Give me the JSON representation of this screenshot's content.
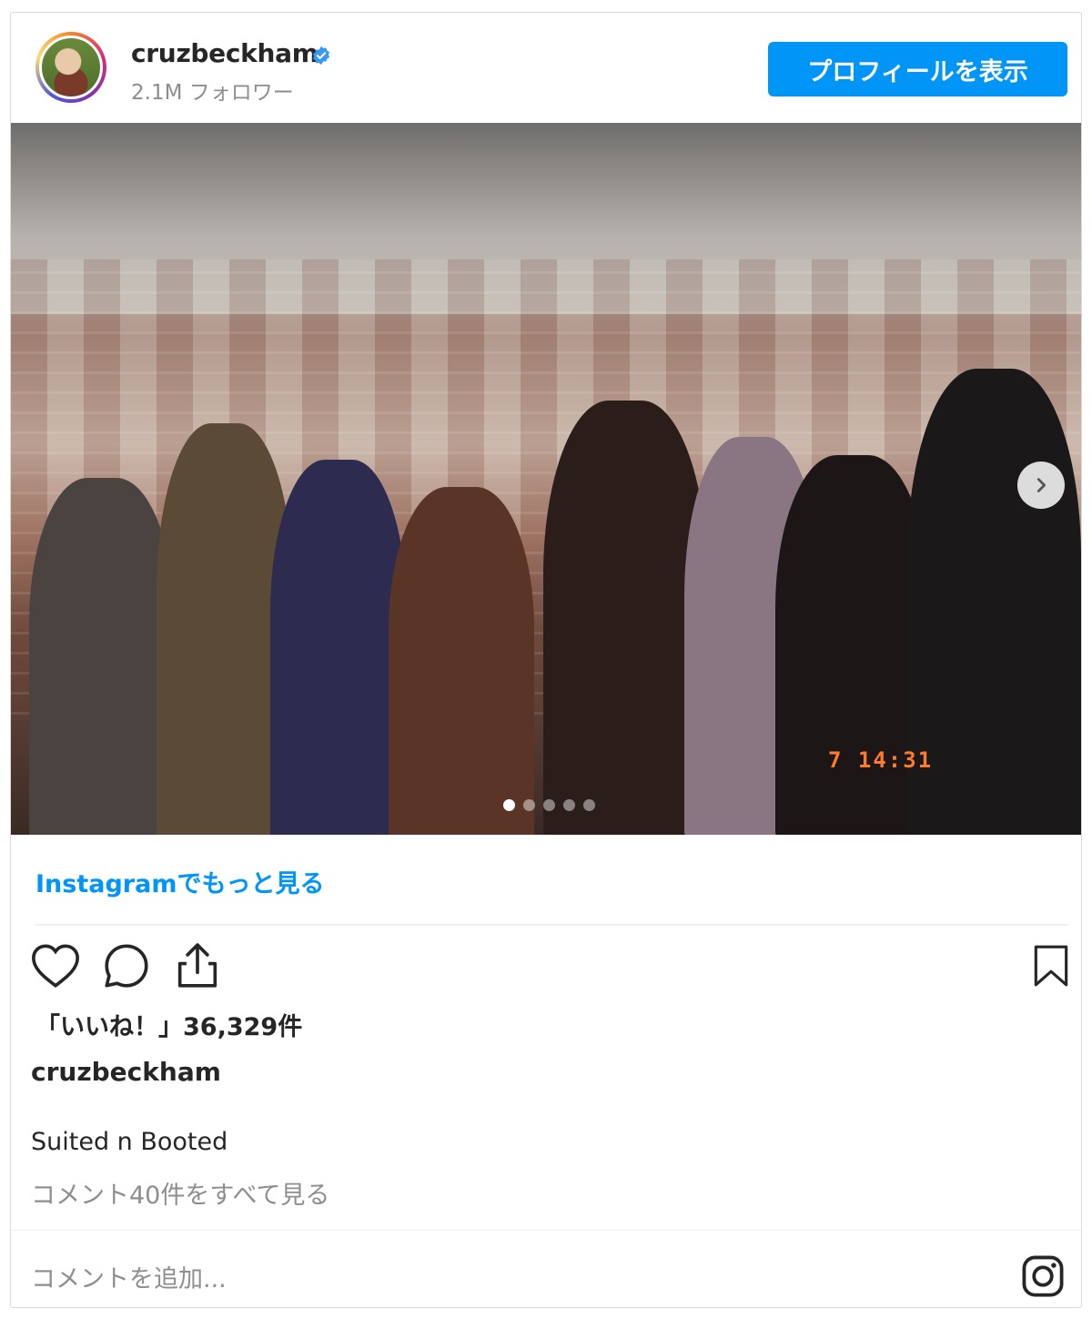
{
  "post": {
    "username": "cruzbeckham",
    "followers": "2.1M フォロワー",
    "profile_button": "プロフィールを表示",
    "carousel": {
      "current": 1,
      "total": 5
    },
    "photo_timestamp": "7 14:31",
    "more_link": "Instagramでもっと見る",
    "likes": "「いいね！」36,329件",
    "caption_username": "cruzbeckham",
    "caption": "Suited n Booted",
    "view_comments": "コメント40件をすべて見る",
    "add_comment_placeholder": "コメントを追加..."
  },
  "colors": {
    "accent": "#0095f6",
    "verified": "#3897f0",
    "secondary_text": "#8e8e8e"
  },
  "icons": [
    "verified-badge-icon",
    "heart-icon",
    "comment-icon",
    "share-icon",
    "bookmark-icon",
    "chevron-right-icon",
    "instagram-logo-icon"
  ]
}
